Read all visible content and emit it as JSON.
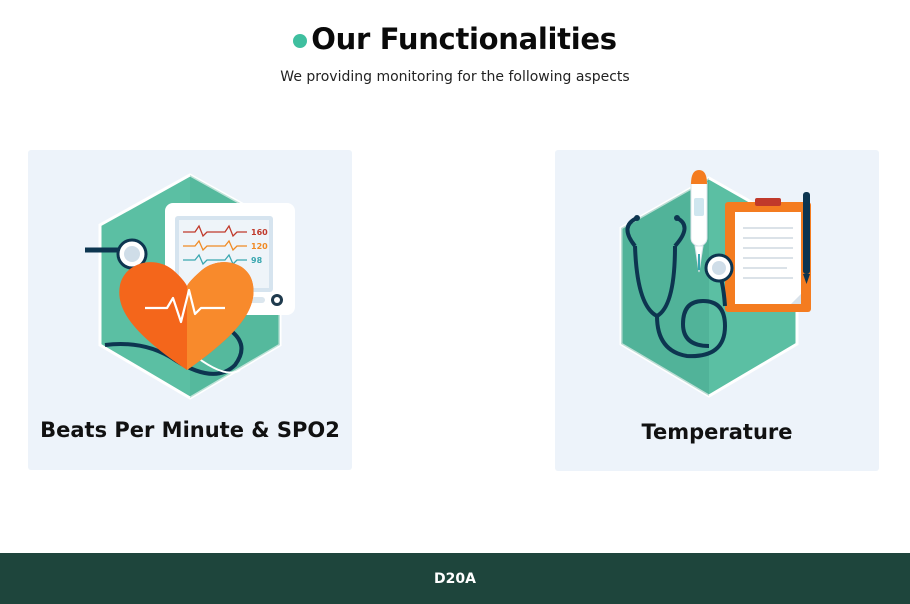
{
  "section": {
    "title": "Our Functionalities",
    "subtitle": "We providing monitoring for the following aspects"
  },
  "cards": [
    {
      "label": "Beats Per Minute & SPO2",
      "icon": "heart-monitor-icon",
      "monitor_readings": [
        "160",
        "120",
        "98"
      ]
    },
    {
      "label": "Temperature",
      "icon": "thermometer-stethoscope-icon"
    }
  ],
  "footer": {
    "text": "D20A"
  },
  "colors": {
    "accent": "#3fbf9f",
    "card_bg": "#edf3fa",
    "footer_bg": "#1e453c",
    "hexagon": "#5bbfa3",
    "heart": "#f4661b"
  }
}
